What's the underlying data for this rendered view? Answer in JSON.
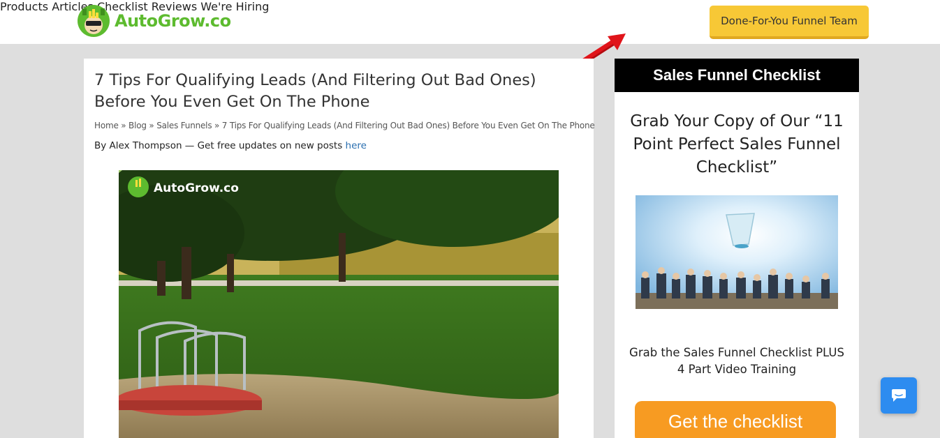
{
  "header": {
    "logo_text": "AutoGrow.co",
    "nav": [
      "Products",
      "Articles",
      "Checklist",
      "Reviews",
      "We're Hiring"
    ],
    "cta": "Done-For-You Funnel Team"
  },
  "article": {
    "title": "7 Tips For Qualifying Leads (And Filtering Out Bad Ones) Before You Even Get On The Phone",
    "breadcrumb": {
      "home": "Home",
      "blog": "Blog",
      "category": "Sales Funnels",
      "current": "7 Tips For Qualifying Leads (And Filtering Out Bad Ones) Before You Even Get On The Phone",
      "sep": "»"
    },
    "byline": {
      "text": "By Alex Thompson — Get free updates on new posts ",
      "link": "here"
    },
    "hero_watermark": "AutoGrow.co"
  },
  "sidebar": {
    "heading": "Sales Funnel Checklist",
    "grab": "Grab Your Copy of Our “11 Point Perfect Sales Funnel Checklist”",
    "sub": "Grab the Sales Funnel Checklist PLUS 4 Part Video Training",
    "button": "Get the checklist"
  },
  "colors": {
    "brand_green": "#5dbb2f",
    "cta_yellow": "#f7c836",
    "button_orange": "#f79b22",
    "chat_blue": "#2d8cf0",
    "arrow_red": "#e0141a"
  },
  "icons": {
    "chat": "chat-bubble-icon",
    "logo": "robot-mascot-icon"
  }
}
